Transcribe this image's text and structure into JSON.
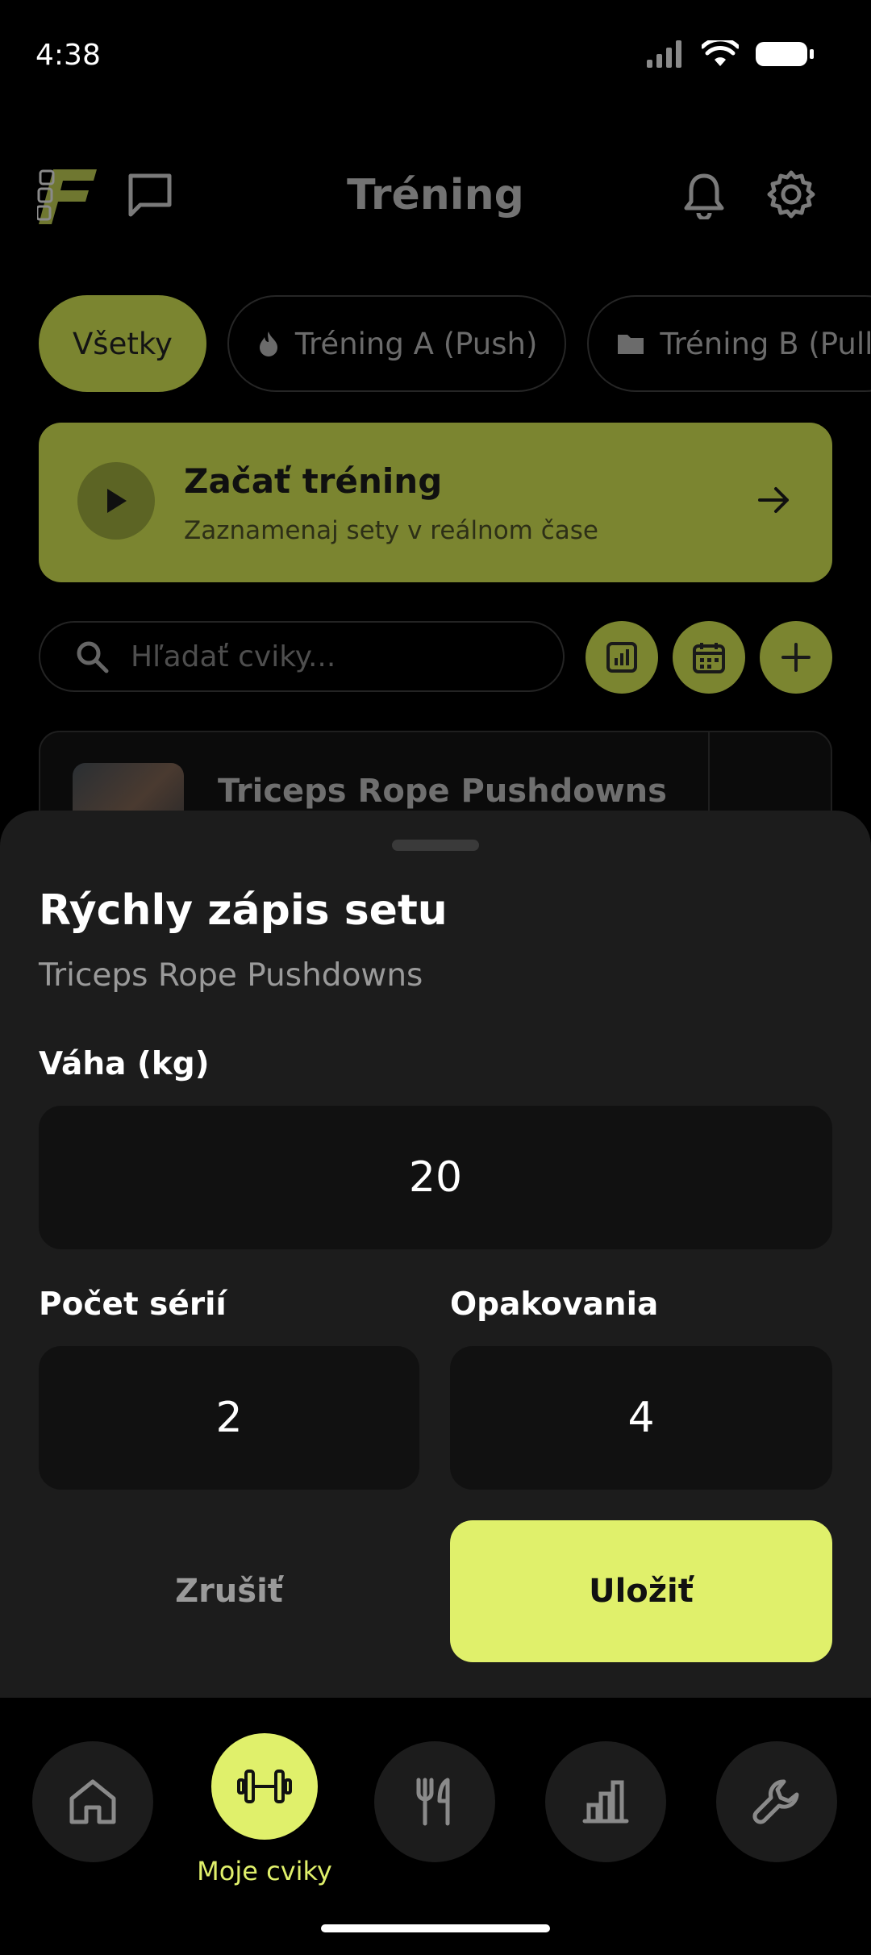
{
  "status": {
    "time": "4:38"
  },
  "header": {
    "title": "Tréning"
  },
  "chips": [
    {
      "label": "Všetky",
      "icon": ""
    },
    {
      "label": "Tréning A (Push)",
      "icon": "flame-icon"
    },
    {
      "label": "Tréning B (Pull)",
      "icon": "folder-icon"
    }
  ],
  "start": {
    "title": "Začať tréning",
    "subtitle": "Zaznamenaj sety v reálnom čase"
  },
  "search": {
    "placeholder": "Hľadať cviky..."
  },
  "exercise": {
    "name": "Triceps Rope Pushdowns"
  },
  "sheet": {
    "title": "Rýchly zápis setu",
    "subtitle": "Triceps Rope Pushdowns",
    "weight_label": "Váha (kg)",
    "weight_value": "20",
    "sets_label": "Počet sérií",
    "sets_value": "2",
    "reps_label": "Opakovania",
    "reps_value": "4",
    "cancel": "Zrušiť",
    "save": "Uložiť"
  },
  "nav": {
    "active_label": "Moje cviky"
  },
  "colors": {
    "accent": "#e0f06b",
    "accent_dim": "#7b8530",
    "sheet_bg": "#1c1c1c"
  }
}
